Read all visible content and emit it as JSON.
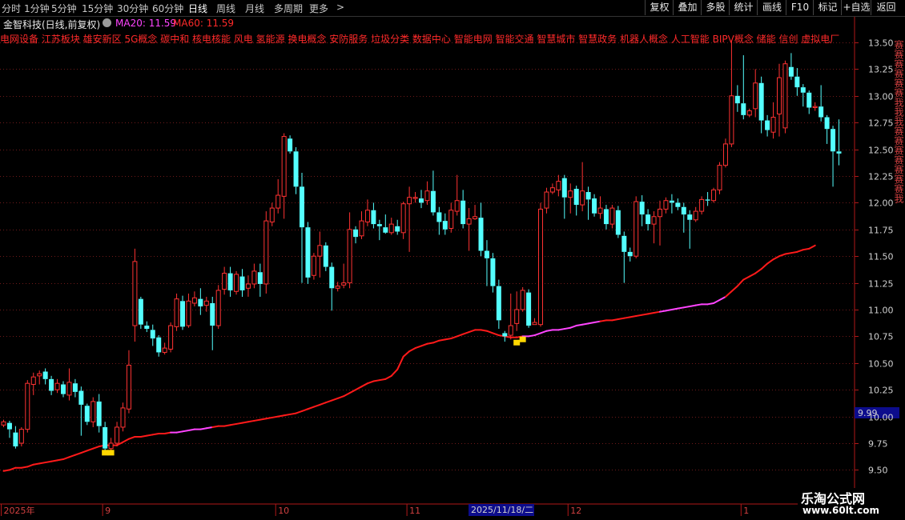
{
  "toolbar": {
    "periods": [
      "分时",
      "1分钟",
      "5分钟",
      "15分钟",
      "30分钟",
      "60分钟",
      "日线",
      "周线",
      "月线",
      "多周期",
      "更多"
    ],
    "active_period": "日线",
    "more_arrow": ">",
    "buttons": [
      "复权",
      "叠加",
      "多股",
      "统计",
      "画线",
      "F10",
      "标记",
      "+自选",
      "返回"
    ]
  },
  "info": {
    "title": "金智科技(日线,前复权)",
    "ma20_label": "MA20: 11.59",
    "ma60_label": "MA60: 11.59"
  },
  "concepts": "电网设备 江苏板块 雄安新区 5G概念 碳中和 核电核能 风电 氢能源 换电概念 安防服务 垃圾分类 数据中心 智能电网 智能交通 智慧城市 智慧政务 机器人概念 人工智能 BIPV概念 储能 信创 虚拟电厂",
  "right_strip": "赛赛赛赛赛赛我我我赛赛赛赛赛赛赛我",
  "colors": {
    "up": "#ff3232",
    "down": "#54ffff",
    "ma_main": "#ff1a1a",
    "ma_alt": "#ff44ff",
    "marker": "#ffd700",
    "grid": "#6e1a1a",
    "axis": "#b01818",
    "price_box": "#0c0c8c"
  },
  "price_box": "9.99",
  "date_box": "2025/11/18/二",
  "watermark": {
    "line1": "乐淘公式网",
    "line2": "www.60lt.com"
  },
  "chart_data": {
    "type": "candlestick",
    "y_ticks": [
      "13.50",
      "13.25",
      "13.00",
      "12.75",
      "12.50",
      "12.25",
      "12.00",
      "11.75",
      "11.50",
      "11.25",
      "11.00",
      "10.75",
      "10.50",
      "10.25",
      "10.00",
      "9.75",
      "9.50"
    ],
    "ylim": [
      9.45,
      13.65
    ],
    "x_labels": [
      {
        "label": "2025年",
        "index": 0
      },
      {
        "label": "9",
        "index": 17
      },
      {
        "label": "10",
        "index": 46
      },
      {
        "label": "11",
        "index": 68
      },
      {
        "label": "12",
        "index": 95
      },
      {
        "label": "1",
        "index": 124
      }
    ],
    "candles": [
      [
        9.92,
        9.95,
        9.97,
        9.9
      ],
      [
        9.94,
        9.88,
        9.96,
        9.8
      ],
      [
        9.85,
        9.72,
        9.91,
        9.7
      ],
      [
        9.75,
        9.88,
        9.9,
        9.72
      ],
      [
        9.88,
        10.31,
        10.34,
        9.85
      ],
      [
        10.3,
        10.37,
        10.41,
        10.2
      ],
      [
        10.38,
        10.4,
        10.43,
        10.3
      ],
      [
        10.42,
        10.35,
        10.45,
        10.3
      ],
      [
        10.35,
        10.24,
        10.38,
        10.2
      ],
      [
        10.25,
        10.31,
        10.35,
        10.22
      ],
      [
        10.3,
        10.21,
        10.33,
        10.18
      ],
      [
        10.2,
        10.32,
        10.45,
        10.15
      ],
      [
        10.31,
        10.23,
        10.35,
        10.18
      ],
      [
        10.24,
        10.11,
        10.28,
        9.82
      ],
      [
        10.1,
        9.95,
        10.12,
        9.92
      ],
      [
        9.95,
        10.14,
        10.18,
        9.9
      ],
      [
        10.14,
        9.91,
        10.21,
        9.85
      ],
      [
        9.9,
        9.7,
        9.95,
        9.68
      ],
      [
        9.7,
        9.75,
        9.8,
        9.68
      ],
      [
        9.75,
        9.9,
        9.95,
        9.72
      ],
      [
        9.9,
        10.08,
        10.13,
        9.86
      ],
      [
        10.07,
        10.48,
        10.62,
        10.03
      ],
      [
        10.85,
        11.45,
        11.57,
        10.7
      ],
      [
        11.1,
        10.86,
        11.12,
        10.82
      ],
      [
        10.85,
        10.82,
        10.89,
        10.79
      ],
      [
        10.81,
        10.73,
        10.86,
        10.66
      ],
      [
        10.74,
        10.6,
        10.76,
        10.56
      ],
      [
        10.6,
        10.64,
        10.69,
        10.58
      ],
      [
        10.63,
        10.85,
        10.88,
        10.6
      ],
      [
        10.84,
        11.1,
        11.15,
        10.8
      ],
      [
        11.08,
        10.84,
        11.13,
        10.81
      ],
      [
        10.85,
        11.08,
        11.15,
        10.83
      ],
      [
        11.06,
        11.11,
        11.17,
        11.03
      ],
      [
        11.1,
        11.03,
        11.2,
        10.95
      ],
      [
        11.04,
        11.08,
        11.12,
        10.98
      ],
      [
        11.06,
        10.85,
        11.12,
        10.62
      ],
      [
        10.85,
        11.18,
        11.23,
        10.82
      ],
      [
        11.19,
        11.34,
        11.4,
        11.14
      ],
      [
        11.34,
        11.18,
        11.4,
        11.12
      ],
      [
        11.17,
        11.33,
        11.36,
        11.14
      ],
      [
        11.31,
        11.18,
        11.38,
        11.12
      ],
      [
        11.2,
        11.24,
        11.32,
        11.12
      ],
      [
        11.24,
        11.36,
        11.43,
        11.2
      ],
      [
        11.35,
        11.24,
        11.43,
        11.12
      ],
      [
        11.24,
        11.83,
        11.92,
        11.15
      ],
      [
        11.82,
        11.95,
        12.0,
        11.78
      ],
      [
        11.95,
        12.07,
        12.22,
        11.9
      ],
      [
        12.06,
        12.62,
        12.65,
        11.85
      ],
      [
        12.6,
        12.48,
        12.63,
        12.46
      ],
      [
        12.48,
        12.15,
        12.52,
        12.08
      ],
      [
        12.15,
        11.77,
        12.28,
        11.25
      ],
      [
        11.77,
        11.3,
        11.82,
        11.24
      ],
      [
        11.32,
        11.5,
        11.53,
        11.28
      ],
      [
        11.5,
        11.6,
        11.73,
        11.3
      ],
      [
        11.6,
        11.4,
        11.63,
        11.36
      ],
      [
        11.4,
        11.2,
        11.44,
        10.99
      ],
      [
        11.2,
        11.22,
        11.26,
        11.17
      ],
      [
        11.23,
        11.25,
        11.43,
        11.2
      ],
      [
        11.25,
        11.75,
        11.91,
        11.2
      ],
      [
        11.75,
        11.68,
        11.78,
        11.62
      ],
      [
        11.69,
        11.83,
        11.92,
        11.66
      ],
      [
        11.82,
        11.93,
        12.03,
        11.78
      ],
      [
        11.93,
        11.8,
        12.0,
        11.76
      ],
      [
        11.8,
        11.78,
        11.84,
        11.65
      ],
      [
        11.77,
        11.72,
        11.89,
        11.71
      ],
      [
        11.72,
        11.8,
        11.86,
        11.7
      ],
      [
        11.78,
        11.73,
        11.84,
        11.7
      ],
      [
        11.72,
        11.99,
        12.01,
        11.66
      ],
      [
        11.99,
        12.05,
        12.15,
        11.54
      ],
      [
        12.04,
        12.05,
        12.1,
        12.0
      ],
      [
        12.04,
        12.0,
        12.12,
        11.95
      ],
      [
        12.02,
        12.11,
        12.2,
        11.98
      ],
      [
        12.11,
        11.91,
        12.3,
        11.88
      ],
      [
        11.91,
        11.82,
        11.96,
        11.7
      ],
      [
        11.83,
        11.75,
        11.9,
        11.7
      ],
      [
        11.76,
        11.93,
        12.0,
        11.72
      ],
      [
        11.92,
        12.02,
        12.26,
        11.88
      ],
      [
        12.02,
        11.8,
        12.12,
        11.76
      ],
      [
        11.8,
        11.85,
        11.95,
        11.55
      ],
      [
        11.85,
        11.87,
        11.98,
        11.84
      ],
      [
        11.86,
        11.55,
        12.0,
        11.5
      ],
      [
        11.55,
        11.48,
        11.65,
        11.22
      ],
      [
        11.48,
        11.22,
        11.53,
        11.16
      ],
      [
        11.22,
        10.9,
        11.28,
        10.82
      ],
      [
        10.78,
        10.75,
        10.8,
        10.7
      ],
      [
        10.76,
        10.85,
        11.15,
        10.72
      ],
      [
        10.87,
        11.0,
        11.17,
        10.8
      ],
      [
        11.0,
        11.18,
        11.21,
        10.98
      ],
      [
        11.16,
        10.85,
        11.19,
        10.83
      ],
      [
        10.86,
        10.88,
        10.92,
        10.86
      ],
      [
        10.86,
        11.94,
        12.0,
        10.84
      ],
      [
        11.95,
        12.1,
        12.14,
        11.9
      ],
      [
        12.1,
        12.14,
        12.18,
        12.08
      ],
      [
        12.12,
        12.2,
        12.26,
        12.06
      ],
      [
        12.23,
        12.05,
        12.26,
        11.85
      ],
      [
        12.05,
        12.11,
        12.18,
        11.9
      ],
      [
        12.13,
        11.98,
        12.16,
        11.88
      ],
      [
        11.98,
        12.11,
        12.38,
        11.92
      ],
      [
        12.1,
        12.03,
        12.15,
        11.84
      ],
      [
        12.04,
        11.9,
        12.08,
        11.87
      ],
      [
        11.9,
        11.95,
        12.06,
        11.85
      ],
      [
        11.94,
        11.8,
        11.98,
        11.75
      ],
      [
        11.8,
        11.95,
        11.98,
        11.76
      ],
      [
        11.93,
        11.7,
        11.97,
        11.67
      ],
      [
        11.69,
        11.54,
        11.73,
        11.25
      ],
      [
        11.54,
        11.5,
        11.58,
        11.45
      ],
      [
        11.5,
        12.01,
        12.06,
        11.48
      ],
      [
        12.01,
        11.89,
        12.07,
        11.78
      ],
      [
        11.89,
        11.8,
        11.94,
        11.74
      ],
      [
        11.8,
        11.87,
        11.92,
        11.62
      ],
      [
        11.87,
        11.94,
        12.02,
        11.6
      ],
      [
        11.94,
        12.02,
        12.05,
        11.9
      ],
      [
        12.02,
        12.0,
        12.08,
        11.9
      ],
      [
        12.0,
        11.96,
        12.04,
        11.93
      ],
      [
        11.96,
        11.89,
        12.0,
        11.72
      ],
      [
        11.89,
        11.84,
        11.93,
        11.57
      ],
      [
        11.84,
        11.92,
        11.96,
        11.82
      ],
      [
        11.92,
        12.03,
        12.06,
        11.89
      ],
      [
        12.03,
        12.02,
        12.1,
        11.97
      ],
      [
        12.02,
        12.12,
        12.14,
        12.0
      ],
      [
        12.12,
        12.35,
        12.38,
        12.08
      ],
      [
        12.35,
        12.55,
        12.6,
        12.33
      ],
      [
        12.55,
        13.0,
        13.52,
        12.52
      ],
      [
        13.0,
        12.93,
        13.1,
        12.85
      ],
      [
        12.93,
        12.82,
        13.38,
        12.78
      ],
      [
        12.82,
        12.86,
        12.88,
        12.8
      ],
      [
        12.88,
        13.12,
        13.25,
        12.8
      ],
      [
        13.12,
        12.77,
        13.18,
        12.65
      ],
      [
        12.77,
        12.68,
        12.82,
        12.62
      ],
      [
        12.66,
        12.8,
        12.94,
        12.6
      ],
      [
        12.83,
        13.17,
        13.3,
        12.62
      ],
      [
        12.7,
        13.3,
        13.33,
        12.65
      ],
      [
        13.27,
        13.18,
        13.4,
        13.15
      ],
      [
        13.18,
        13.08,
        13.26,
        13.0
      ],
      [
        13.08,
        13.03,
        13.11,
        12.9
      ],
      [
        13.03,
        12.89,
        13.05,
        12.83
      ],
      [
        12.89,
        12.9,
        12.94,
        12.86
      ],
      [
        12.9,
        12.8,
        13.1,
        12.76
      ],
      [
        12.8,
        12.69,
        12.82,
        12.55
      ],
      [
        12.69,
        12.48,
        12.72,
        12.15
      ],
      [
        12.48,
        12.46,
        12.78,
        12.35
      ]
    ],
    "ma_line": [
      9.49,
      9.5,
      9.52,
      9.52,
      9.53,
      9.55,
      9.56,
      9.57,
      9.58,
      9.59,
      9.6,
      9.62,
      9.64,
      9.66,
      9.68,
      9.7,
      9.72,
      9.73,
      9.73,
      9.73,
      9.76,
      9.79,
      9.81,
      9.81,
      9.82,
      9.83,
      9.84,
      9.84,
      9.85,
      9.85,
      9.86,
      9.87,
      9.88,
      9.88,
      9.89,
      9.9,
      9.91,
      9.91,
      9.92,
      9.93,
      9.94,
      9.95,
      9.96,
      9.97,
      9.98,
      9.99,
      10.0,
      10.01,
      10.02,
      10.03,
      10.05,
      10.07,
      10.09,
      10.11,
      10.13,
      10.15,
      10.17,
      10.19,
      10.22,
      10.25,
      10.28,
      10.31,
      10.33,
      10.34,
      10.35,
      10.38,
      10.44,
      10.56,
      10.61,
      10.64,
      10.66,
      10.68,
      10.69,
      10.71,
      10.72,
      10.73,
      10.75,
      10.77,
      10.79,
      10.81,
      10.81,
      10.8,
      10.78,
      10.76,
      10.75,
      10.74,
      10.74,
      10.75,
      10.75,
      10.76,
      10.78,
      10.8,
      10.81,
      10.81,
      10.82,
      10.83,
      10.85,
      10.86,
      10.87,
      10.88,
      10.89,
      10.9,
      10.9,
      10.91,
      10.92,
      10.93,
      10.94,
      10.95,
      10.96,
      10.97,
      10.98,
      10.99,
      11.0,
      11.01,
      11.02,
      11.03,
      11.04,
      11.05,
      11.05,
      11.06,
      11.09,
      11.12,
      11.17,
      11.22,
      11.28,
      11.31,
      11.34,
      11.38,
      11.43,
      11.47,
      11.5,
      11.52,
      11.53,
      11.54,
      11.56,
      11.57,
      11.6
    ],
    "ma_alt_segments": [
      [
        28,
        35
      ],
      [
        87,
        100
      ],
      [
        110,
        121
      ]
    ],
    "markers": [
      {
        "index": 17,
        "price": 9.68
      },
      {
        "index": 18,
        "price": 9.68
      },
      {
        "index": 86,
        "price": 10.71
      },
      {
        "index": 87,
        "price": 10.74
      }
    ]
  }
}
